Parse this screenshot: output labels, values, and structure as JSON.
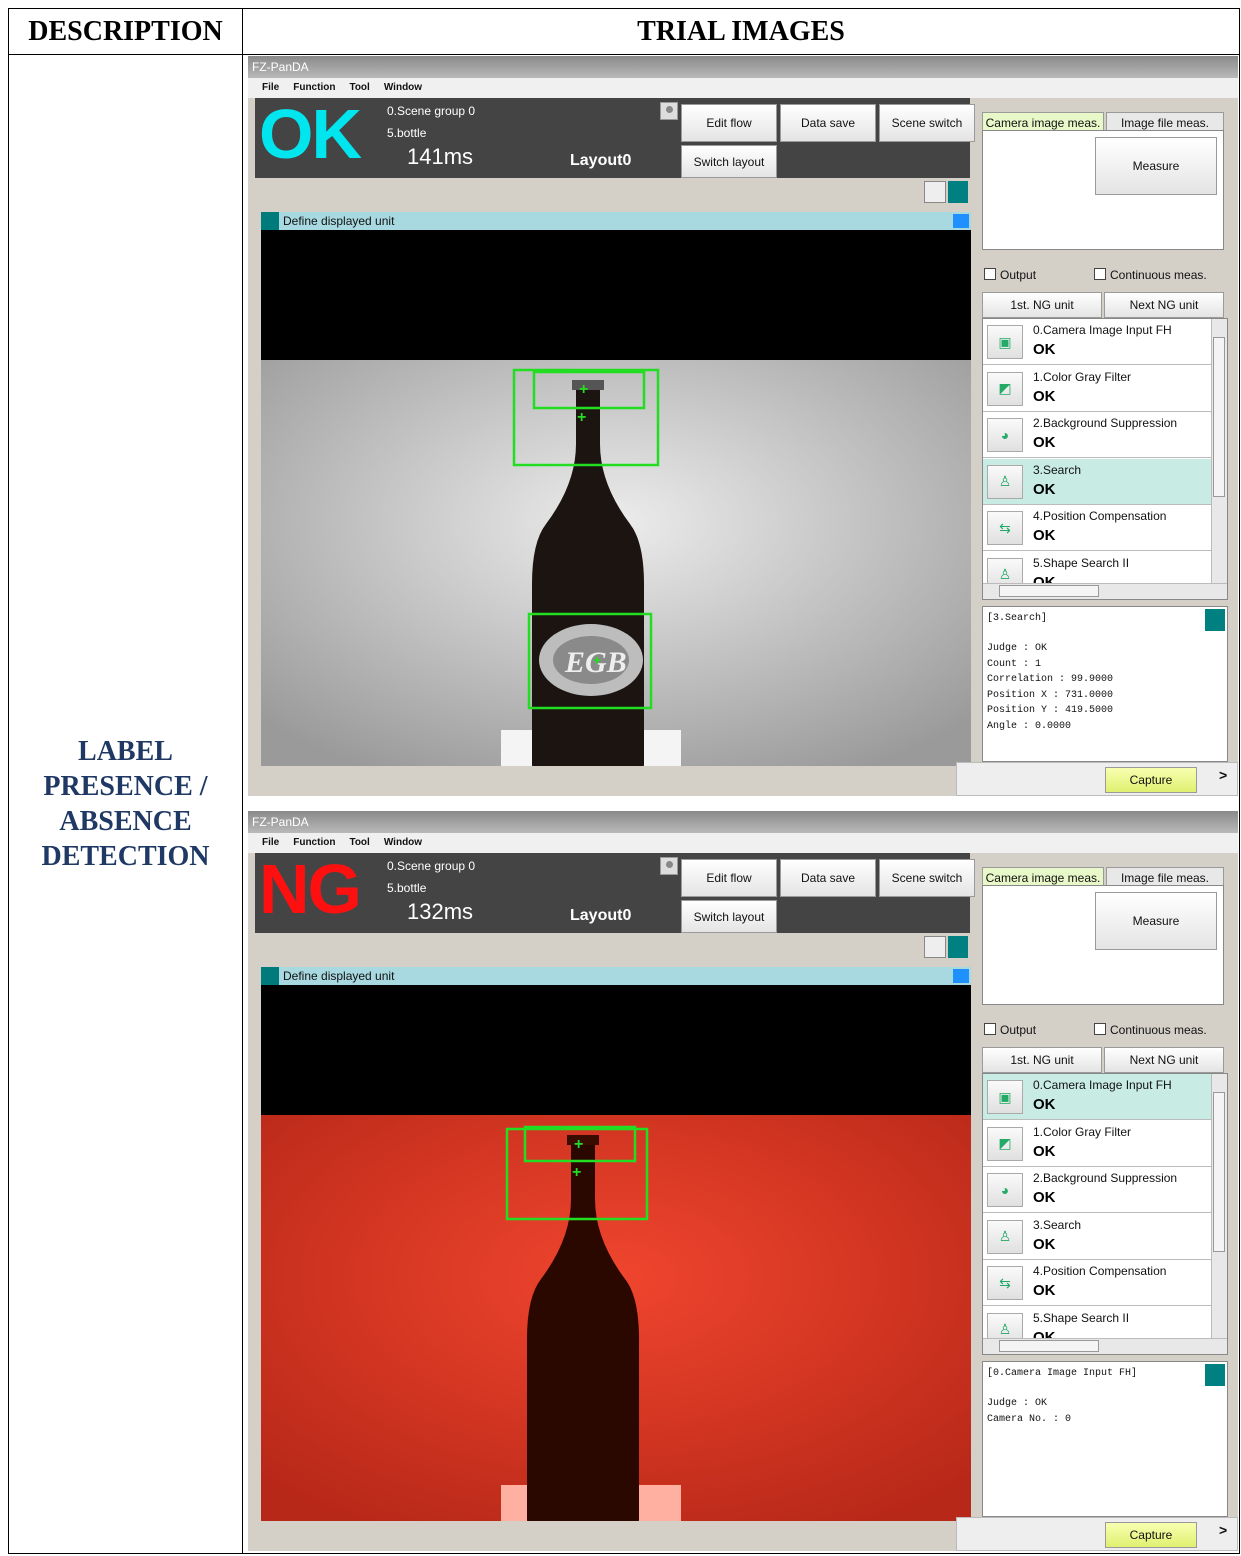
{
  "table": {
    "header_description": "DESCRIPTION",
    "header_trial": "TRIAL IMAGES",
    "row_description": "LABEL PRESENCE / ABSENCE DETECTION"
  },
  "screens": [
    {
      "app_title": "FZ-PanDA",
      "menu": [
        "File",
        "Function",
        "Tool",
        "Window"
      ],
      "judge": "OK",
      "judge_color": "#00e5ee",
      "scene_group": "0.Scene group 0",
      "scene": "5.bottle",
      "time": "141ms",
      "layout": "Layout0",
      "buttons": {
        "edit_flow": "Edit flow",
        "data_save": "Data save",
        "scene_switch": "Scene switch",
        "switch_layout": "Switch layout"
      },
      "unit_bar": "Define displayed unit",
      "tabs": {
        "camera": "Camera image meas.",
        "file": "Image file meas."
      },
      "measure": "Measure",
      "output": "Output",
      "continuous": "Continuous meas.",
      "ng_buttons": {
        "first": "1st. NG unit",
        "next": "Next NG unit"
      },
      "selected_unit": 3,
      "units": [
        {
          "name": "0.Camera Image Input FH",
          "judge": "OK"
        },
        {
          "name": "1.Color Gray Filter",
          "judge": "OK"
        },
        {
          "name": "2.Background Suppression",
          "judge": "OK"
        },
        {
          "name": "3.Search",
          "judge": "OK"
        },
        {
          "name": "4.Position Compensation",
          "judge": "OK"
        },
        {
          "name": "5.Shape Search II",
          "judge": "OK"
        }
      ],
      "detail_header": "[3.Search]",
      "detail_lines": [
        "Judge : OK",
        "Count : 1",
        "Correlation : 99.9000",
        "Position X : 731.0000",
        "Position Y : 419.5000",
        "Angle : 0.0000"
      ],
      "capture": "Capture",
      "image_tint": "gray"
    },
    {
      "app_title": "FZ-PanDA",
      "menu": [
        "File",
        "Function",
        "Tool",
        "Window"
      ],
      "judge": "NG",
      "judge_color": "#ff1010",
      "scene_group": "0.Scene group 0",
      "scene": "5.bottle",
      "time": "132ms",
      "layout": "Layout0",
      "buttons": {
        "edit_flow": "Edit flow",
        "data_save": "Data save",
        "scene_switch": "Scene switch",
        "switch_layout": "Switch layout"
      },
      "unit_bar": "Define displayed unit",
      "tabs": {
        "camera": "Camera image meas.",
        "file": "Image file meas."
      },
      "measure": "Measure",
      "output": "Output",
      "continuous": "Continuous meas.",
      "ng_buttons": {
        "first": "1st. NG unit",
        "next": "Next NG unit"
      },
      "selected_unit": 0,
      "units": [
        {
          "name": "0.Camera Image Input FH",
          "judge": "OK"
        },
        {
          "name": "1.Color Gray Filter",
          "judge": "OK"
        },
        {
          "name": "2.Background Suppression",
          "judge": "OK"
        },
        {
          "name": "3.Search",
          "judge": "OK"
        },
        {
          "name": "4.Position Compensation",
          "judge": "OK"
        },
        {
          "name": "5.Shape Search II",
          "judge": "OK"
        }
      ],
      "detail_header": "[0.Camera Image Input FH]",
      "detail_lines": [
        "Judge : OK",
        "Camera No. : 0"
      ],
      "capture": "Capture",
      "image_tint": "red"
    }
  ]
}
